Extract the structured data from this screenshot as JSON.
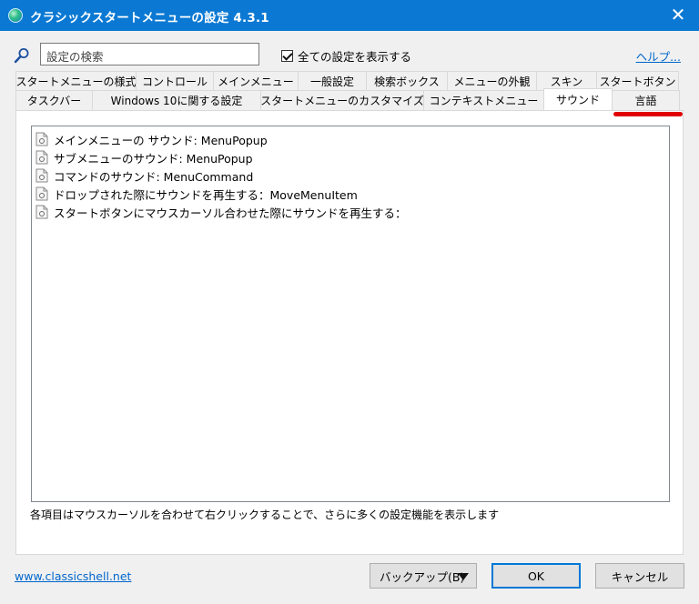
{
  "window": {
    "title": "クラシックスタートメニューの設定 4.3.1",
    "close_glyph": "✕"
  },
  "search": {
    "placeholder": "設定の検索",
    "value": ""
  },
  "show_all_settings": {
    "label": "全ての設定を表示する",
    "checked": true
  },
  "help_link": "ヘルプ...",
  "tabs": {
    "row1": [
      {
        "label": "スタートメニューの様式"
      },
      {
        "label": "コントロール"
      },
      {
        "label": "メインメニュー"
      },
      {
        "label": "一般設定"
      },
      {
        "label": "検索ボックス"
      },
      {
        "label": "メニューの外観"
      },
      {
        "label": "スキン"
      },
      {
        "label": "スタートボタン"
      }
    ],
    "row2": [
      {
        "label": "タスクバー"
      },
      {
        "label": "Windows 10に関する設定"
      },
      {
        "label": "スタートメニューのカスタマイズ"
      },
      {
        "label": "コンテキストメニュー"
      },
      {
        "label": "サウンド",
        "active": true
      },
      {
        "label": "言語",
        "highlighted": true
      }
    ]
  },
  "sound_items": [
    {
      "label": "メインメニューの サウンド: MenuPopup"
    },
    {
      "label": "サブメニューのサウンド: MenuPopup"
    },
    {
      "label": "コマンドのサウンド: MenuCommand"
    },
    {
      "label": "ドロップされた際にサウンドを再生する：MoveMenuItem"
    },
    {
      "label": "スタートボタンにマウスカーソル合わせた際にサウンドを再生する："
    }
  ],
  "hint": "各項目はマウスカーソルを合わせて右クリックすることで、さらに多くの設定機能を表示します",
  "footer": {
    "site_link": "www.classicshell.net",
    "backup_label": "バックアップ(B)",
    "ok_label": "OK",
    "cancel_label": "キャンセル"
  },
  "colors": {
    "titlebar": "#0b79d3",
    "link": "#0066cc",
    "highlight_mark": "#e00000",
    "ok_border": "#0078d7"
  }
}
